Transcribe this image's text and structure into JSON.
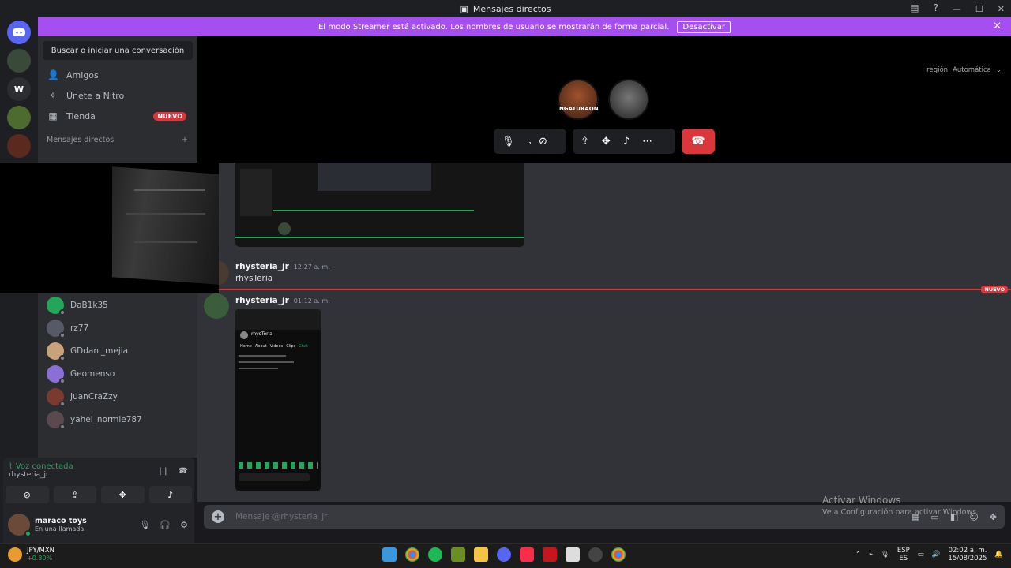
{
  "window": {
    "title": "Mensajes directos"
  },
  "banner": {
    "text": "El modo Streamer está activado. Los nombres de usuario se mostrarán de forma parcial.",
    "button": "Desactivar"
  },
  "guilds": {
    "w_label": "W"
  },
  "sidebar": {
    "search_label": "Buscar o iniciar una conversación",
    "nav": [
      {
        "label": "Amigos",
        "icon": "friends-icon"
      },
      {
        "label": "Únete a Nitro",
        "icon": "nitro-icon"
      },
      {
        "label": "Tienda",
        "icon": "shop-icon",
        "badge": "NUEVO"
      }
    ],
    "dm_header": "Mensajes directos",
    "friends": [
      {
        "name": "DaB1k35",
        "color": "#23a55a"
      },
      {
        "name": "rz77",
        "color": "#555b66"
      },
      {
        "name": "GDdani_mejia",
        "color": "#c9a27a"
      },
      {
        "name": "Geomenso",
        "color": "#8b6fd6"
      },
      {
        "name": "JuanCraZzy",
        "color": "#7a3b2e"
      },
      {
        "name": "yahel_normie787",
        "color": "#5a4a4f"
      }
    ]
  },
  "call": {
    "region_label": "región",
    "region_value": "Automática",
    "participant_caption": "NGATURAON"
  },
  "chat": {
    "messages": [
      {
        "author": "rhysteria_jr",
        "time": "12:27 a. m.",
        "text": "rhysTeria"
      },
      {
        "author": "rhysteria_jr",
        "time": "01:12 a. m.",
        "text": ""
      }
    ],
    "new_label": "NUEVO",
    "phone": {
      "title": "rhysTeria",
      "tabs": [
        "Home",
        "About",
        "Videos",
        "Clips",
        "Chat"
      ]
    },
    "composer_placeholder": "Mensaje @rhysteria_jr"
  },
  "voice": {
    "status": "Voz conectada",
    "channel": "rhysteria_jr"
  },
  "user": {
    "name": "maraco toys",
    "status": "En una llamada"
  },
  "activation": {
    "title": "Activar Windows",
    "subtitle": "Ve a Configuración para activar Windows."
  },
  "taskbar": {
    "ticker": "JPY/MXN",
    "ticker_change": "+0.30%",
    "lang1": "ESP",
    "lang2": "ES",
    "time": "02:02 a. m.",
    "date": "15/08/2025"
  },
  "colors": {
    "accent": "#a64ff0",
    "danger": "#da373c",
    "online": "#23a55a",
    "blurple": "#5865f2"
  }
}
